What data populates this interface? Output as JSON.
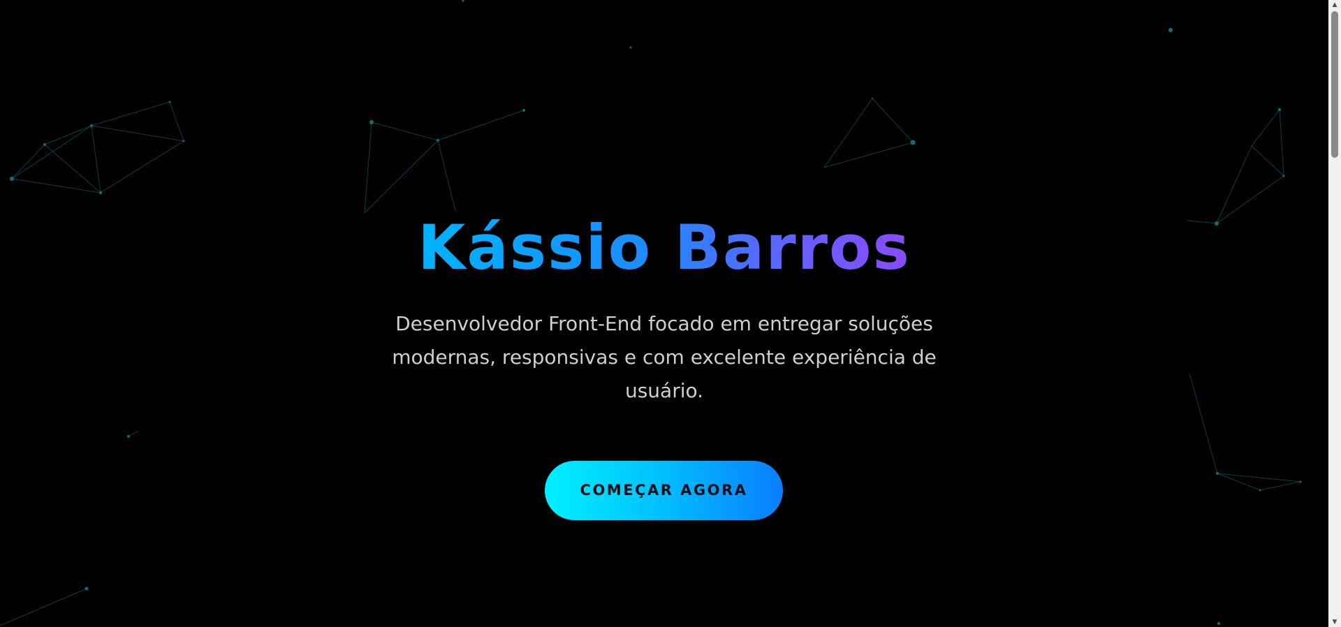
{
  "hero": {
    "title": "Kássio Barros",
    "subtitle": "Desenvolvedor Front-End focado em entregar soluções modernas, responsivas e com excelente experiência de usuário.",
    "cta_label": "COMEÇAR AGORA"
  },
  "colors": {
    "background": "#000000",
    "particle": "#0f6f78",
    "title_gradient_start": "#00b4ff",
    "title_gradient_end": "#8a4bff",
    "button_gradient_start": "#00f0ff",
    "button_gradient_end": "#0a7dff",
    "subtitle": "#cfcfcf"
  },
  "scrollbar": {
    "up_icon": "scroll-up-arrow-icon",
    "down_icon": "scroll-down-arrow-icon"
  }
}
